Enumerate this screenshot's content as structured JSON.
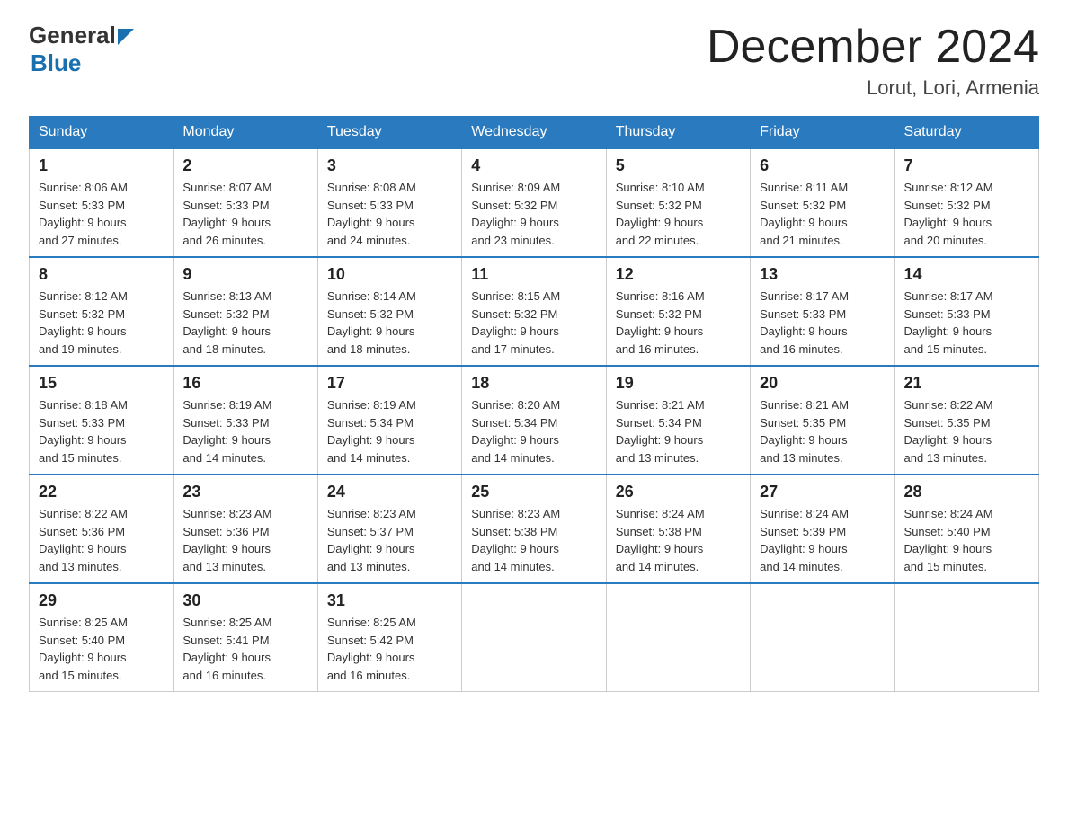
{
  "logo": {
    "general": "General",
    "blue": "Blue"
  },
  "title": "December 2024",
  "subtitle": "Lorut, Lori, Armenia",
  "days_of_week": [
    "Sunday",
    "Monday",
    "Tuesday",
    "Wednesday",
    "Thursday",
    "Friday",
    "Saturday"
  ],
  "weeks": [
    [
      {
        "day": "1",
        "sunrise": "8:06 AM",
        "sunset": "5:33 PM",
        "daylight": "9 hours and 27 minutes."
      },
      {
        "day": "2",
        "sunrise": "8:07 AM",
        "sunset": "5:33 PM",
        "daylight": "9 hours and 26 minutes."
      },
      {
        "day": "3",
        "sunrise": "8:08 AM",
        "sunset": "5:33 PM",
        "daylight": "9 hours and 24 minutes."
      },
      {
        "day": "4",
        "sunrise": "8:09 AM",
        "sunset": "5:32 PM",
        "daylight": "9 hours and 23 minutes."
      },
      {
        "day": "5",
        "sunrise": "8:10 AM",
        "sunset": "5:32 PM",
        "daylight": "9 hours and 22 minutes."
      },
      {
        "day": "6",
        "sunrise": "8:11 AM",
        "sunset": "5:32 PM",
        "daylight": "9 hours and 21 minutes."
      },
      {
        "day": "7",
        "sunrise": "8:12 AM",
        "sunset": "5:32 PM",
        "daylight": "9 hours and 20 minutes."
      }
    ],
    [
      {
        "day": "8",
        "sunrise": "8:12 AM",
        "sunset": "5:32 PM",
        "daylight": "9 hours and 19 minutes."
      },
      {
        "day": "9",
        "sunrise": "8:13 AM",
        "sunset": "5:32 PM",
        "daylight": "9 hours and 18 minutes."
      },
      {
        "day": "10",
        "sunrise": "8:14 AM",
        "sunset": "5:32 PM",
        "daylight": "9 hours and 18 minutes."
      },
      {
        "day": "11",
        "sunrise": "8:15 AM",
        "sunset": "5:32 PM",
        "daylight": "9 hours and 17 minutes."
      },
      {
        "day": "12",
        "sunrise": "8:16 AM",
        "sunset": "5:32 PM",
        "daylight": "9 hours and 16 minutes."
      },
      {
        "day": "13",
        "sunrise": "8:17 AM",
        "sunset": "5:33 PM",
        "daylight": "9 hours and 16 minutes."
      },
      {
        "day": "14",
        "sunrise": "8:17 AM",
        "sunset": "5:33 PM",
        "daylight": "9 hours and 15 minutes."
      }
    ],
    [
      {
        "day": "15",
        "sunrise": "8:18 AM",
        "sunset": "5:33 PM",
        "daylight": "9 hours and 15 minutes."
      },
      {
        "day": "16",
        "sunrise": "8:19 AM",
        "sunset": "5:33 PM",
        "daylight": "9 hours and 14 minutes."
      },
      {
        "day": "17",
        "sunrise": "8:19 AM",
        "sunset": "5:34 PM",
        "daylight": "9 hours and 14 minutes."
      },
      {
        "day": "18",
        "sunrise": "8:20 AM",
        "sunset": "5:34 PM",
        "daylight": "9 hours and 14 minutes."
      },
      {
        "day": "19",
        "sunrise": "8:21 AM",
        "sunset": "5:34 PM",
        "daylight": "9 hours and 13 minutes."
      },
      {
        "day": "20",
        "sunrise": "8:21 AM",
        "sunset": "5:35 PM",
        "daylight": "9 hours and 13 minutes."
      },
      {
        "day": "21",
        "sunrise": "8:22 AM",
        "sunset": "5:35 PM",
        "daylight": "9 hours and 13 minutes."
      }
    ],
    [
      {
        "day": "22",
        "sunrise": "8:22 AM",
        "sunset": "5:36 PM",
        "daylight": "9 hours and 13 minutes."
      },
      {
        "day": "23",
        "sunrise": "8:23 AM",
        "sunset": "5:36 PM",
        "daylight": "9 hours and 13 minutes."
      },
      {
        "day": "24",
        "sunrise": "8:23 AM",
        "sunset": "5:37 PM",
        "daylight": "9 hours and 13 minutes."
      },
      {
        "day": "25",
        "sunrise": "8:23 AM",
        "sunset": "5:38 PM",
        "daylight": "9 hours and 14 minutes."
      },
      {
        "day": "26",
        "sunrise": "8:24 AM",
        "sunset": "5:38 PM",
        "daylight": "9 hours and 14 minutes."
      },
      {
        "day": "27",
        "sunrise": "8:24 AM",
        "sunset": "5:39 PM",
        "daylight": "9 hours and 14 minutes."
      },
      {
        "day": "28",
        "sunrise": "8:24 AM",
        "sunset": "5:40 PM",
        "daylight": "9 hours and 15 minutes."
      }
    ],
    [
      {
        "day": "29",
        "sunrise": "8:25 AM",
        "sunset": "5:40 PM",
        "daylight": "9 hours and 15 minutes."
      },
      {
        "day": "30",
        "sunrise": "8:25 AM",
        "sunset": "5:41 PM",
        "daylight": "9 hours and 16 minutes."
      },
      {
        "day": "31",
        "sunrise": "8:25 AM",
        "sunset": "5:42 PM",
        "daylight": "9 hours and 16 minutes."
      },
      null,
      null,
      null,
      null
    ]
  ],
  "labels": {
    "sunrise": "Sunrise:",
    "sunset": "Sunset:",
    "daylight": "Daylight:"
  }
}
